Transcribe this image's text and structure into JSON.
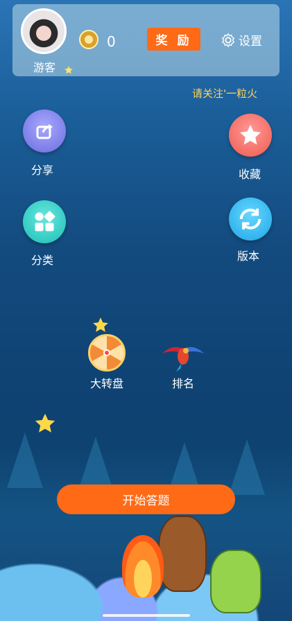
{
  "header": {
    "user_name": "游客",
    "coin_value": "0",
    "reward_label": "奖 励",
    "settings_label": "设置",
    "notice_text": "请关注'一粒火"
  },
  "actions": {
    "share_label": "分享",
    "favorite_label": "收藏",
    "category_label": "分类",
    "version_label": "版本",
    "wheel_label": "大转盘",
    "rank_label": "排名"
  },
  "start_button": {
    "label": "开始答题"
  },
  "icons": {
    "share": "share-icon",
    "favorite": "star-icon",
    "category": "category-icon",
    "version": "refresh-icon",
    "settings": "gear-icon",
    "coin": "coin-icon",
    "wheel": "wheel-icon",
    "rank": "parrot-icon"
  },
  "colors": {
    "accent": "#ff6a16",
    "notice": "#ffd35a"
  }
}
